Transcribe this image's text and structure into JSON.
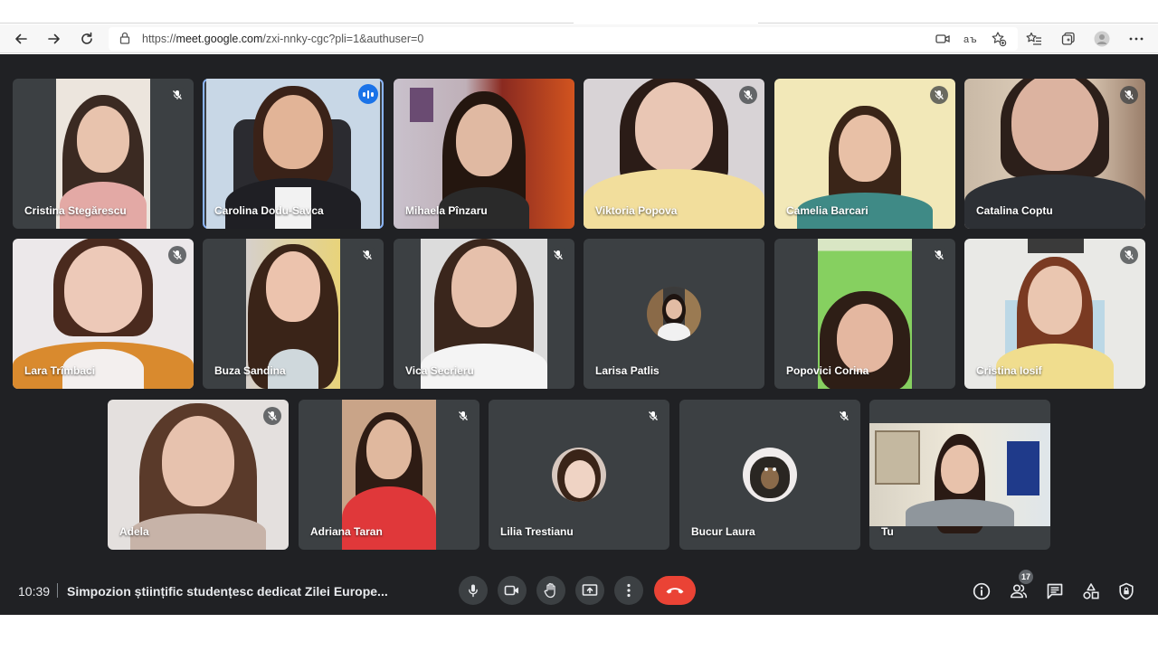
{
  "browser": {
    "url_prefix": "https://",
    "url_host": "meet.google.com",
    "url_path": "/zxi-nnky-cgc?pli=1&authuser=0"
  },
  "participants": [
    {
      "name": "Cristina Stegărescu",
      "muted": true
    },
    {
      "name": "Carolina Dodu-Savca",
      "muted": false,
      "speaking": true
    },
    {
      "name": "Mihaela Pînzaru",
      "muted": false
    },
    {
      "name": "Viktoria Popova",
      "muted": true
    },
    {
      "name": "Camelia Barcari",
      "muted": true
    },
    {
      "name": "Catalina Coptu",
      "muted": true
    },
    {
      "name": "Lara Trîmbaci",
      "muted": true
    },
    {
      "name": "Buza Sandina",
      "muted": true
    },
    {
      "name": "Vica Secrieru",
      "muted": true
    },
    {
      "name": "Larisa Patlis",
      "muted": false,
      "camera_off": true
    },
    {
      "name": "Popovici Corina",
      "muted": true
    },
    {
      "name": "Cristina Iosif",
      "muted": true
    },
    {
      "name": "Adela",
      "muted": true
    },
    {
      "name": "Adriana Taran",
      "muted": true
    },
    {
      "name": "Lilia Trestianu",
      "muted": true,
      "camera_off": true
    },
    {
      "name": "Bucur Laura",
      "muted": true,
      "camera_off": true
    },
    {
      "name": "Tu",
      "muted": false
    }
  ],
  "meeting": {
    "time": "10:39",
    "title": "Simpozion științific studențesc dedicat Zilei Europe..."
  },
  "people_count": "17",
  "colors": {
    "stage_bg": "#202124",
    "tile_bg": "#3c4043",
    "hangup": "#ea4335",
    "speaking_outline": "#8ab4f8",
    "speaking_badge": "#1a73e8"
  },
  "icons": {
    "back": "arrow-left-icon",
    "forward": "arrow-right-icon",
    "reload": "reload-icon",
    "mic": "microphone-icon",
    "camera": "video-camera-icon",
    "raise_hand": "hand-icon",
    "present": "present-screen-icon",
    "more": "more-vertical-icon",
    "hangup": "phone-hangup-icon",
    "info": "info-icon",
    "people": "people-icon",
    "chat": "chat-icon",
    "activities": "activities-icon",
    "safety": "shield-lock-icon"
  }
}
